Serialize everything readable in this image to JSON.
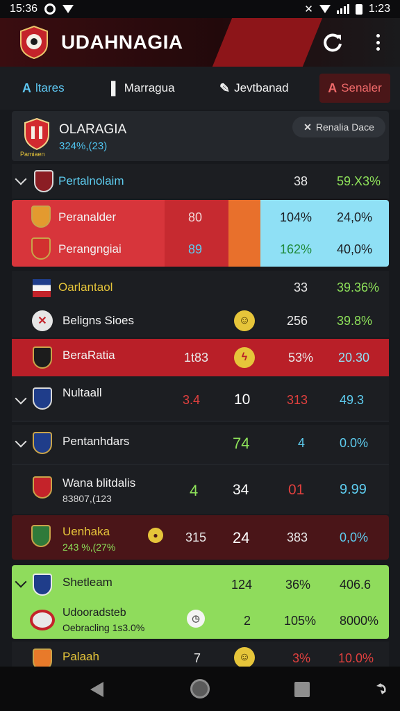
{
  "status_bar": {
    "time": "15:36",
    "right_time": "1:23"
  },
  "app_bar": {
    "title": "UDAHNAGIA"
  },
  "tabs": [
    {
      "label": "ltares",
      "icon": "A"
    },
    {
      "label": "Marragua",
      "icon": "▌"
    },
    {
      "label": "Jevtbanad",
      "icon": "✎"
    },
    {
      "label": "Senaler",
      "icon": "A"
    }
  ],
  "team": {
    "name": "OLARAGIA",
    "stat": "324%,(23)",
    "crest_caption": "Pamiaen",
    "rank_button": "Renalia Dace"
  },
  "rows": [
    {
      "name": "Pertalnolaim",
      "c2": "38",
      "c3": "59.X3%"
    },
    {
      "name": "Peranalder",
      "c1": "80",
      "c2": "104%",
      "c3": "24,0%"
    },
    {
      "name": "Perangngiai",
      "c1": "89",
      "c2": "162%",
      "c3": "40,0%"
    },
    {
      "name": "Oarlantaol",
      "c2": "33",
      "c3": "39.36%"
    },
    {
      "name": "Beligns Sioes",
      "c2": "256",
      "c3": "39.8%"
    },
    {
      "name": "BeraRatia",
      "c1": "1t83",
      "c2": "53%",
      "c3": "20.30"
    },
    {
      "name": "Nultaall",
      "c0": "3.4",
      "c1": "10",
      "c2": "313",
      "c3": "49.3"
    },
    {
      "name": "Pentanhdars",
      "c1": "74",
      "c2": "4",
      "c3": "0.0%"
    },
    {
      "name": "Wana blitdalis",
      "sub": "83807,(123",
      "c0": "4",
      "c1": "34",
      "c2": "01",
      "c3": "9.99"
    },
    {
      "name": "Uenhaka",
      "sub": "243 %,(27%",
      "c0": "315",
      "c1": "24",
      "c2": "383",
      "c3": "0,0%"
    },
    {
      "name": "Shetleam",
      "c1": "124",
      "c2": "36%",
      "c3": "406.6"
    },
    {
      "name": "Udooradsteb",
      "sub": "Oebracling 1s3.0%",
      "c1": "2",
      "c2": "105%",
      "c3": "8000%"
    },
    {
      "name": "Palaah",
      "c1": "7",
      "c2": "3%",
      "c3": "10.0%"
    }
  ],
  "colors": {
    "accent_red": "#c0262c",
    "green": "#8ee25a",
    "cyan": "#5ecdf0",
    "yellow": "#e6c53a"
  }
}
